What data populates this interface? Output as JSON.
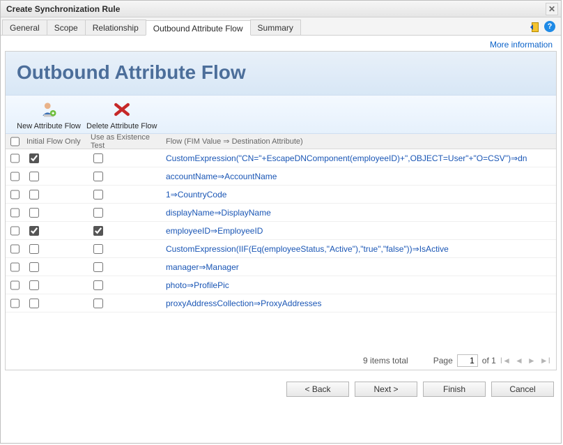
{
  "window": {
    "title": "Create Synchronization Rule"
  },
  "tabs": [
    {
      "label": "General"
    },
    {
      "label": "Scope"
    },
    {
      "label": "Relationship"
    },
    {
      "label": "Outbound Attribute Flow"
    },
    {
      "label": "Summary"
    }
  ],
  "active_tab_index": 3,
  "links": {
    "more_info": "More information"
  },
  "page": {
    "heading": "Outbound Attribute Flow"
  },
  "actions": {
    "new": "New Attribute Flow",
    "delete": "Delete Attribute Flow"
  },
  "grid": {
    "columns": {
      "initial": "Initial Flow Only",
      "existence": "Use as Existence Test",
      "flow": "Flow (FIM Value ⇒ Destination Attribute)"
    },
    "rows": [
      {
        "initial": true,
        "existence": false,
        "flow": "CustomExpression(\"CN=\"+EscapeDNComponent(employeeID)+\",OBJECT=User\"+\"O=CSV\")⇒dn"
      },
      {
        "initial": false,
        "existence": false,
        "flow": "accountName⇒AccountName"
      },
      {
        "initial": false,
        "existence": false,
        "flow": "1⇒CountryCode"
      },
      {
        "initial": false,
        "existence": false,
        "flow": "displayName⇒DisplayName"
      },
      {
        "initial": true,
        "existence": true,
        "flow": "employeeID⇒EmployeeID"
      },
      {
        "initial": false,
        "existence": false,
        "flow": "CustomExpression(IIF(Eq(employeeStatus,\"Active\"),\"true\",\"false\"))⇒IsActive"
      },
      {
        "initial": false,
        "existence": false,
        "flow": "manager⇒Manager"
      },
      {
        "initial": false,
        "existence": false,
        "flow": "photo⇒ProfilePic"
      },
      {
        "initial": false,
        "existence": false,
        "flow": "proxyAddressCollection⇒ProxyAddresses"
      }
    ]
  },
  "pager": {
    "totals": "9 items total",
    "page_label": "Page",
    "page": "1",
    "of_label": "of 1"
  },
  "wizard": {
    "back": "< Back",
    "next": "Next >",
    "finish": "Finish",
    "cancel": "Cancel"
  }
}
